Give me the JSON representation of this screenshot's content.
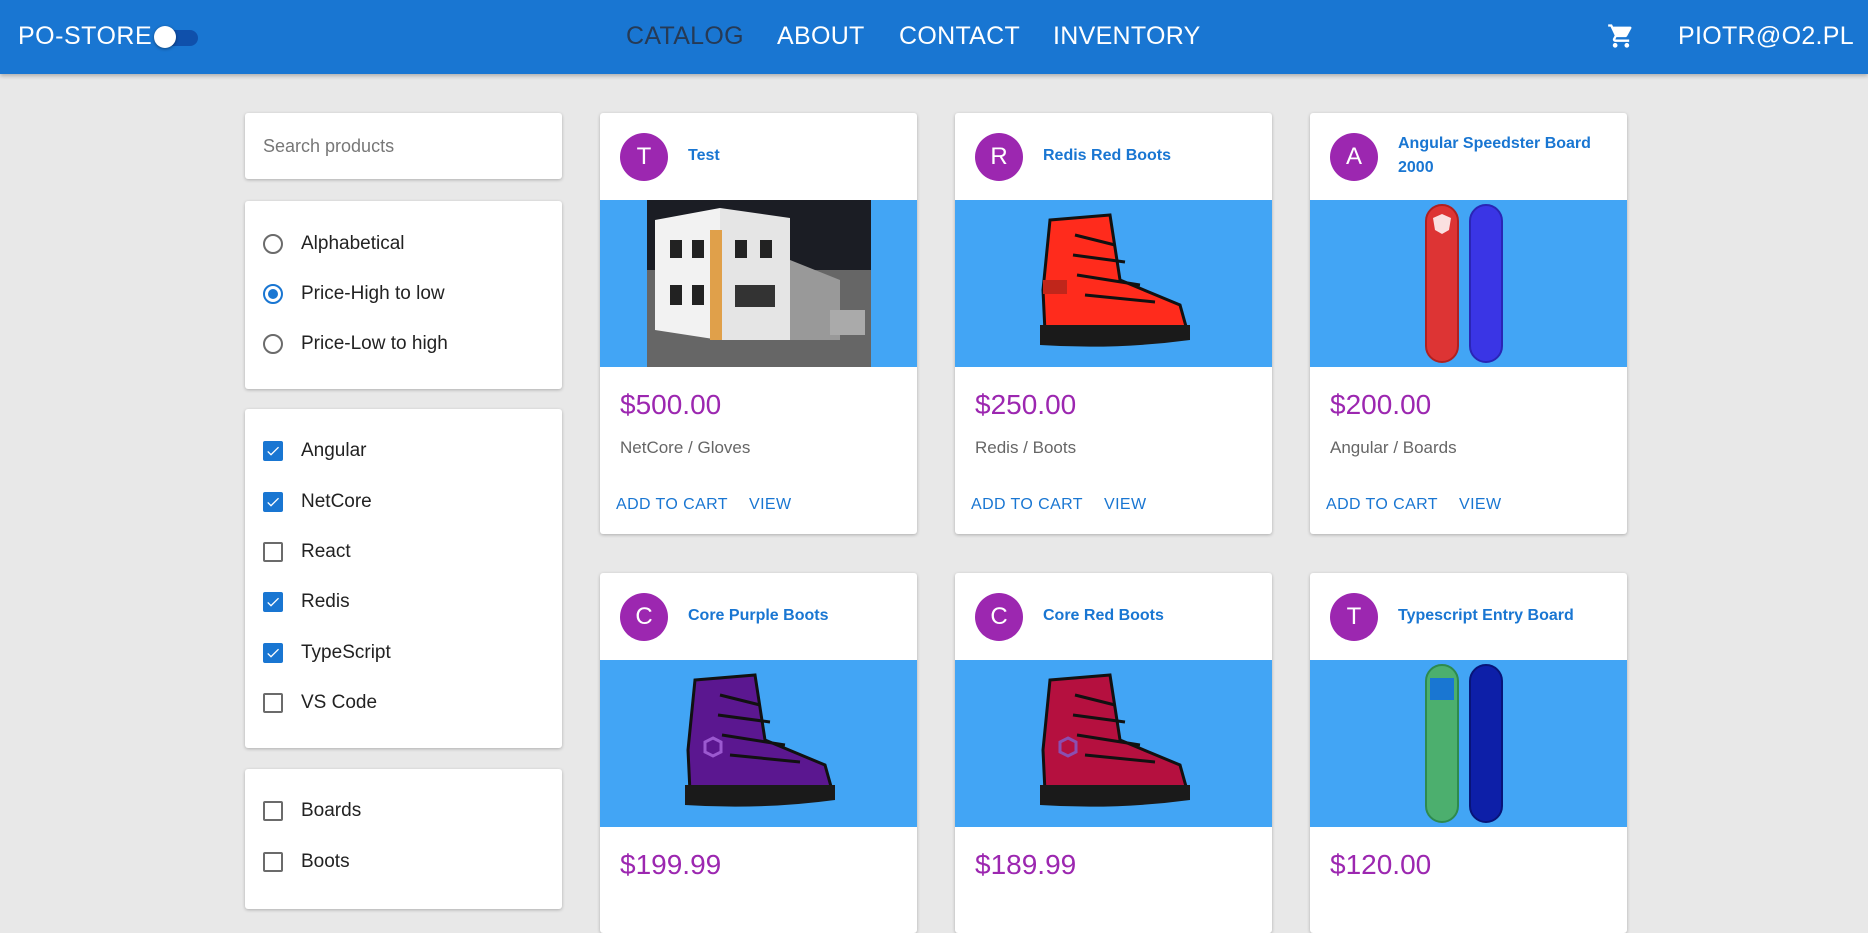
{
  "header": {
    "brand": "PO-STORE",
    "nav": [
      {
        "label": "CATALOG",
        "active": true
      },
      {
        "label": "ABOUT"
      },
      {
        "label": "CONTACT"
      },
      {
        "label": "INVENTORY"
      }
    ],
    "cart_icon": "shopping-cart-icon",
    "user": "PIOTR@O2.PL",
    "accent": "#1976d2"
  },
  "search": {
    "placeholder": "Search products",
    "value": ""
  },
  "sort": {
    "options": [
      "Alphabetical",
      "Price-High to low",
      "Price-Low to high"
    ],
    "selected": "Price-High to low"
  },
  "brands": [
    {
      "label": "Angular",
      "checked": true
    },
    {
      "label": "NetCore",
      "checked": true
    },
    {
      "label": "React",
      "checked": false
    },
    {
      "label": "Redis",
      "checked": true
    },
    {
      "label": "TypeScript",
      "checked": true
    },
    {
      "label": "VS Code",
      "checked": false
    }
  ],
  "types": [
    {
      "label": "Boards",
      "checked": false
    },
    {
      "label": "Boots",
      "checked": false
    }
  ],
  "products": [
    {
      "initial": "T",
      "name": "Test",
      "price": "$500.00",
      "category": "NetCore / Gloves",
      "image": "building-photo"
    },
    {
      "initial": "R",
      "name": "Redis Red Boots",
      "price": "$250.00",
      "category": "Redis / Boots",
      "image": "red-boot",
      "color": "#ff2b1c"
    },
    {
      "initial": "A",
      "name": "Angular Speedster Board 2000",
      "price": "$200.00",
      "category": "Angular / Boards",
      "image": "snowboard-red-blue"
    },
    {
      "initial": "C",
      "name": "Core Purple Boots",
      "price": "$199.99",
      "category": "",
      "image": "purple-boot",
      "color": "#5b1790"
    },
    {
      "initial": "C",
      "name": "Core Red Boots",
      "price": "$189.99",
      "category": "",
      "image": "crimson-boot",
      "color": "#b5103f"
    },
    {
      "initial": "T",
      "name": "Typescript Entry Board",
      "price": "$120.00",
      "category": "",
      "image": "snowboard-green-navy"
    }
  ],
  "actions": {
    "add": "ADD TO CART",
    "view": "VIEW"
  }
}
